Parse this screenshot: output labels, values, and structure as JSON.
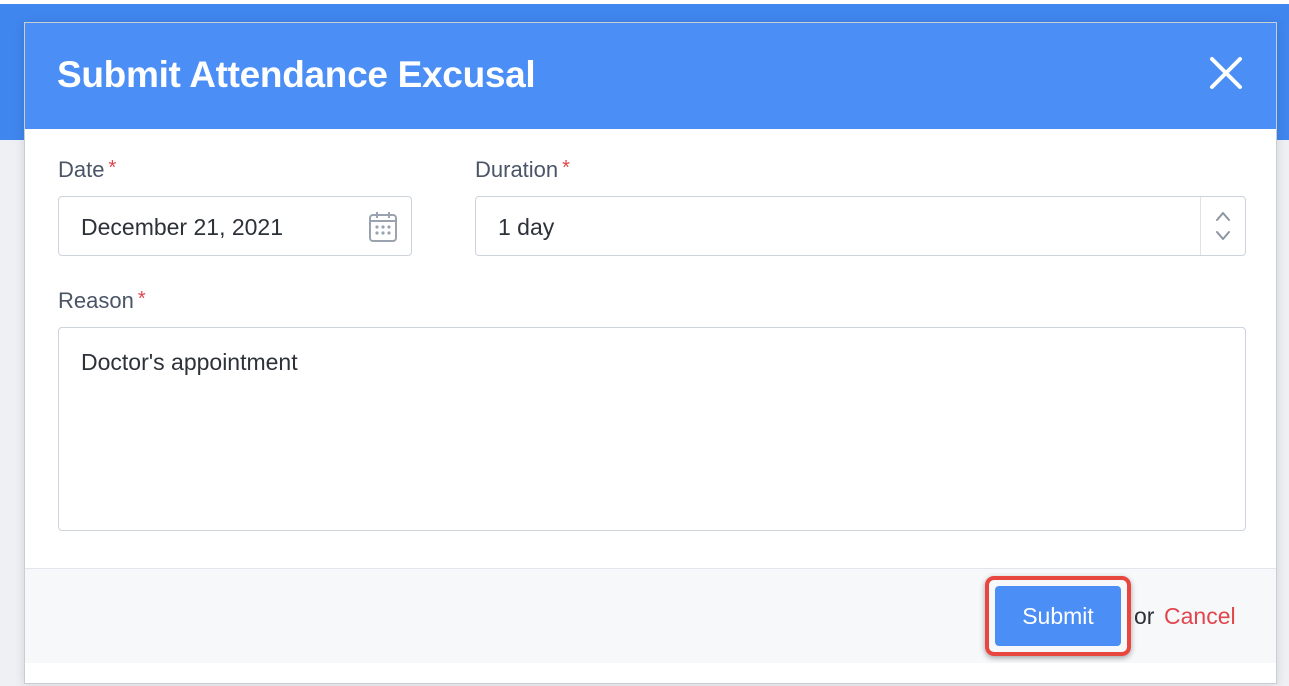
{
  "dialog": {
    "title": "Submit Attendance Excusal",
    "close_icon": "close-icon"
  },
  "fields": {
    "date": {
      "label": "Date",
      "required_mark": "*",
      "value": "December 21, 2021",
      "icon": "calendar-icon"
    },
    "duration": {
      "label": "Duration",
      "required_mark": "*",
      "value": "1 day",
      "icon": "up-down-stepper-icon"
    },
    "reason": {
      "label": "Reason",
      "required_mark": "*",
      "value": "Doctor's appointment"
    }
  },
  "footer": {
    "submit_label": "Submit",
    "or_text": "or",
    "cancel_label": "Cancel"
  },
  "colors": {
    "header": "#4b8ef5",
    "required": "#e0464b",
    "highlight": "#e8473f"
  }
}
